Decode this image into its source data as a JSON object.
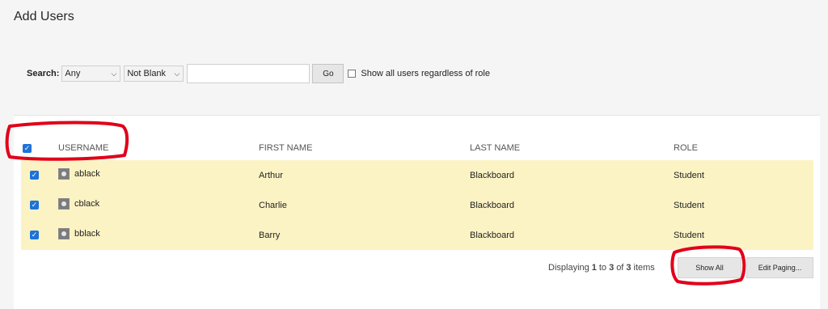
{
  "page": {
    "title": "Add Users"
  },
  "search": {
    "label": "Search:",
    "field_select": "Any",
    "operator_select": "Not Blank",
    "input_value": "",
    "go_label": "Go",
    "show_all_roles_label": "Show all users regardless of role",
    "show_all_roles_checked": false
  },
  "table": {
    "select_all_checked": true,
    "columns": [
      "USERNAME",
      "FIRST NAME",
      "LAST NAME",
      "ROLE"
    ],
    "rows": [
      {
        "username": "ablack",
        "first_name": "Arthur",
        "last_name": "Blackboard",
        "role": "Student",
        "checked": true
      },
      {
        "username": "cblack",
        "first_name": "Charlie",
        "last_name": "Blackboard",
        "role": "Student",
        "checked": true
      },
      {
        "username": "bblack",
        "first_name": "Barry",
        "last_name": "Blackboard",
        "role": "Student",
        "checked": true
      }
    ]
  },
  "paging": {
    "prefix": "Displaying",
    "from": "1",
    "to_word": "to",
    "to": "3",
    "of_word": "of",
    "total": "3",
    "suffix": "items",
    "show_all_label": "Show All",
    "edit_paging_label": "Edit Paging..."
  },
  "colors": {
    "highlight_row": "#fcf3c4",
    "checkbox": "#1e73d8",
    "annotation": "#e0001a"
  }
}
